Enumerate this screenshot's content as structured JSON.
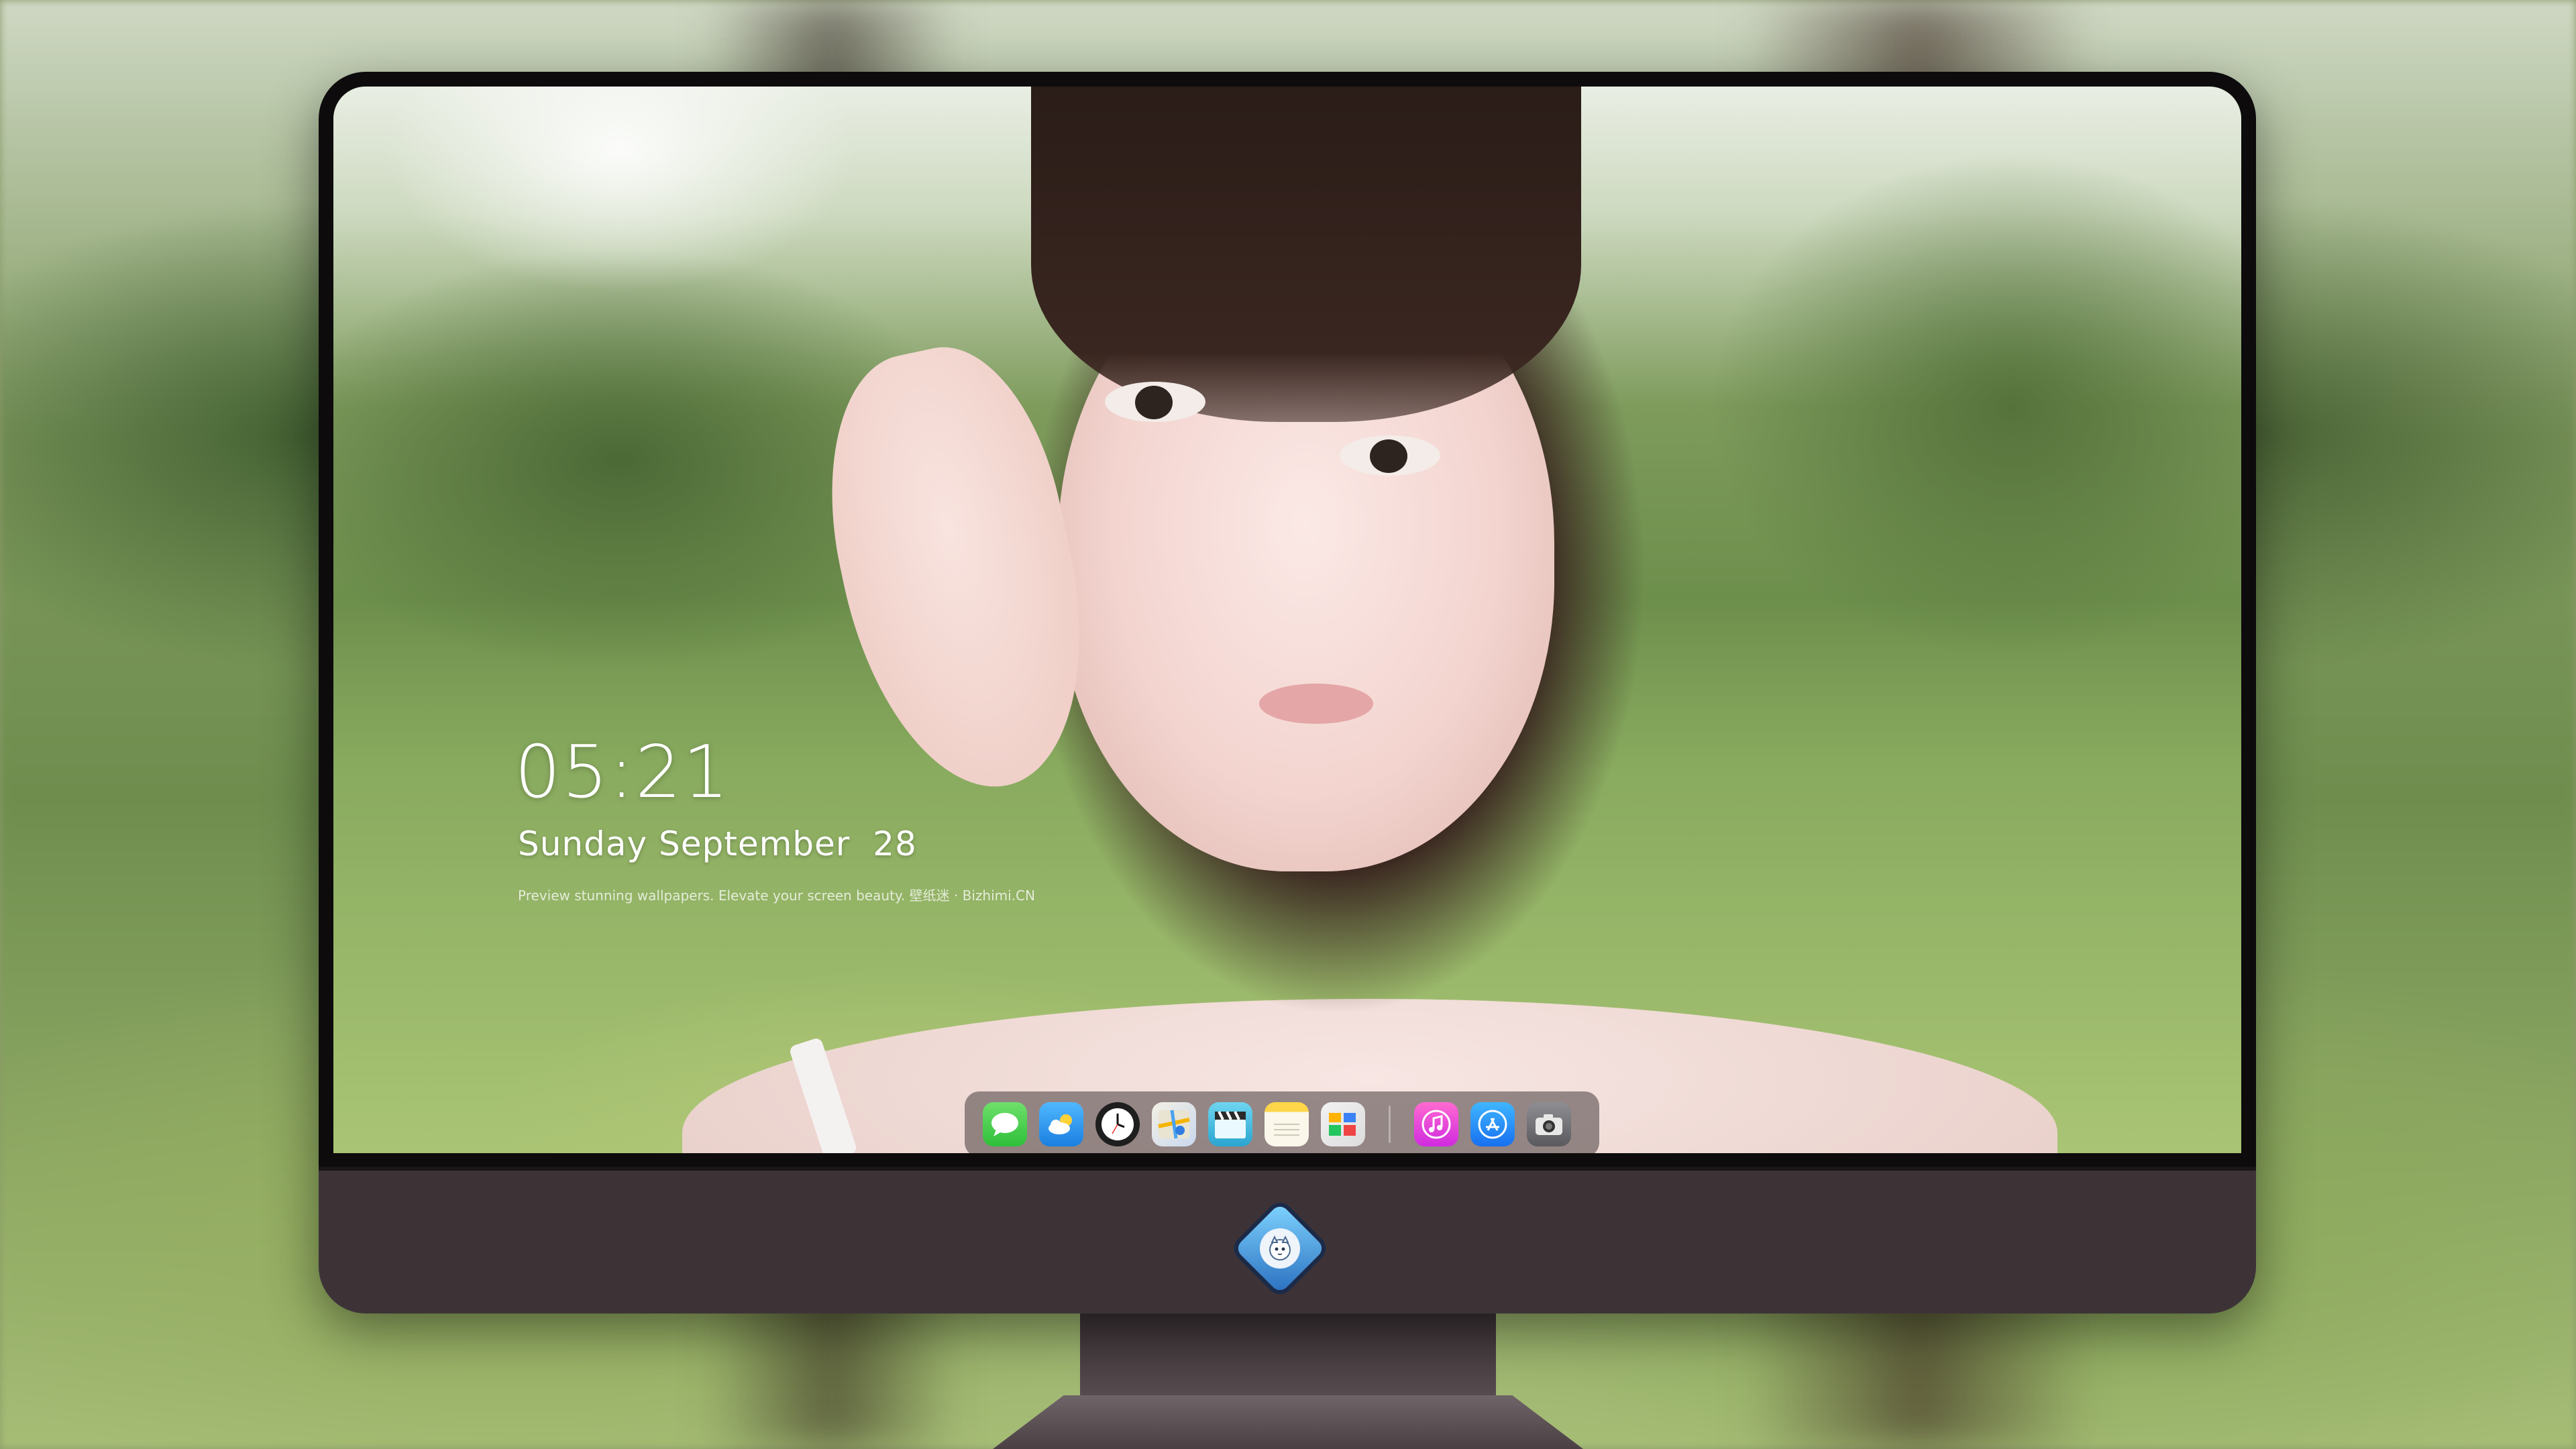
{
  "lock_screen": {
    "time": "05:21",
    "date": "Sunday September  28",
    "tagline": "Preview stunning wallpapers. Elevate your screen beauty. 壁纸迷 · Bizhimi.CN"
  },
  "dock": {
    "apps": [
      {
        "name": "Messages",
        "icon": "messages-icon"
      },
      {
        "name": "Weather",
        "icon": "weather-icon"
      },
      {
        "name": "Clock",
        "icon": "clock-icon"
      },
      {
        "name": "Maps",
        "icon": "maps-icon"
      },
      {
        "name": "Clapper",
        "icon": "clapperboard-icon"
      },
      {
        "name": "Notes",
        "icon": "notes-icon"
      },
      {
        "name": "Pay",
        "icon": "pay-icon"
      },
      {
        "name": "Music",
        "icon": "music-icon"
      },
      {
        "name": "App Store",
        "icon": "app-store-icon"
      },
      {
        "name": "Camera",
        "icon": "camera-icon"
      }
    ]
  },
  "brand_logo": "mascot-logo-icon",
  "colors": {
    "bezel": "#0d0b0c",
    "chin": "#3d3337",
    "text": "#ffffff"
  }
}
